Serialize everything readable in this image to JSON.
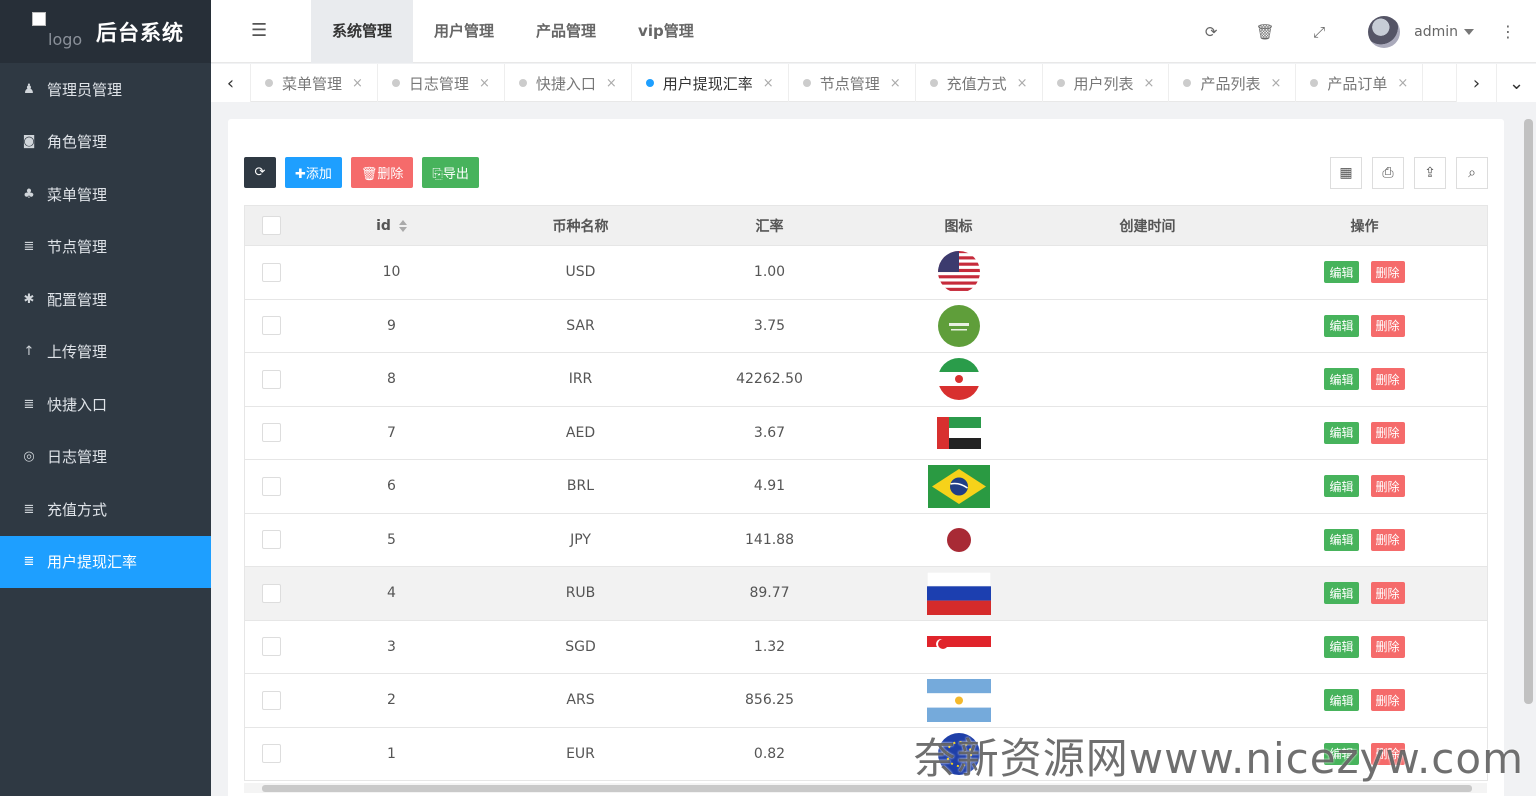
{
  "app": {
    "brand": "后台系统",
    "logo_alt": "logo"
  },
  "sidebar": {
    "items": [
      {
        "label": "管理员管理",
        "icon": "user-icon",
        "glyph": "♟"
      },
      {
        "label": "角色管理",
        "icon": "role-icon",
        "glyph": "◙"
      },
      {
        "label": "菜单管理",
        "icon": "tree-icon",
        "glyph": "♣"
      },
      {
        "label": "节点管理",
        "icon": "list-icon",
        "glyph": "≣"
      },
      {
        "label": "配置管理",
        "icon": "asterisk-icon",
        "glyph": "✱"
      },
      {
        "label": "上传管理",
        "icon": "arrow-up-icon",
        "glyph": "↑"
      },
      {
        "label": "快捷入口",
        "icon": "list-icon",
        "glyph": "≣"
      },
      {
        "label": "日志管理",
        "icon": "globe-icon",
        "glyph": "◎"
      },
      {
        "label": "充值方式",
        "icon": "list-icon",
        "glyph": "≣"
      },
      {
        "label": "用户提现汇率",
        "icon": "list-icon",
        "glyph": "≣"
      }
    ],
    "active_index": 9
  },
  "header": {
    "toggle_glyph": "☰",
    "tabs": [
      "系统管理",
      "用户管理",
      "产品管理",
      "vip管理"
    ],
    "active_tab": 0,
    "icons": [
      {
        "name": "refresh-icon",
        "glyph": "⟳"
      },
      {
        "name": "trash-icon",
        "glyph": "🗑"
      },
      {
        "name": "fullscreen-icon",
        "glyph": "⤢"
      }
    ],
    "user": "admin",
    "more_glyph": "⋮"
  },
  "page_tabs": {
    "items": [
      "菜单管理",
      "日志管理",
      "快捷入口",
      "用户提现汇率",
      "节点管理",
      "充值方式",
      "用户列表",
      "产品列表",
      "产品订单"
    ],
    "active_index": 3,
    "close": "×",
    "left": "‹",
    "right": "›",
    "down": "⌄"
  },
  "toolbar": {
    "refresh_glyph": "⟳",
    "add_label": "✚添加",
    "delete_label": "🗑删除",
    "export_label": "⎘导出",
    "right_tools": [
      {
        "name": "columns-icon",
        "glyph": "▦"
      },
      {
        "name": "print-icon",
        "glyph": "⎙"
      },
      {
        "name": "export-icon",
        "glyph": "⇪"
      },
      {
        "name": "search-icon",
        "glyph": "⌕"
      }
    ]
  },
  "table": {
    "headers": {
      "id": "id",
      "name": "币种名称",
      "rate": "汇率",
      "icon": "图标",
      "time": "创建时间",
      "op": "操作"
    },
    "edit_label": "编辑",
    "delete_label": "删除",
    "rows": [
      {
        "id": "10",
        "name": "USD",
        "rate": "1.00",
        "flag": "us",
        "time": ""
      },
      {
        "id": "9",
        "name": "SAR",
        "rate": "3.75",
        "flag": "sa",
        "time": ""
      },
      {
        "id": "8",
        "name": "IRR",
        "rate": "42262.50",
        "flag": "ir",
        "time": ""
      },
      {
        "id": "7",
        "name": "AED",
        "rate": "3.67",
        "flag": "ae",
        "time": ""
      },
      {
        "id": "6",
        "name": "BRL",
        "rate": "4.91",
        "flag": "br",
        "time": ""
      },
      {
        "id": "5",
        "name": "JPY",
        "rate": "141.88",
        "flag": "jp",
        "time": ""
      },
      {
        "id": "4",
        "name": "RUB",
        "rate": "89.77",
        "flag": "ru",
        "time": ""
      },
      {
        "id": "3",
        "name": "SGD",
        "rate": "1.32",
        "flag": "sg",
        "time": ""
      },
      {
        "id": "2",
        "name": "ARS",
        "rate": "856.25",
        "flag": "ar",
        "time": ""
      },
      {
        "id": "1",
        "name": "EUR",
        "rate": "0.82",
        "flag": "eu",
        "time": ""
      }
    ],
    "hover_row": 6
  },
  "watermark": "奈新资源网www.nicezyw.com",
  "colors": {
    "sidebar": "#2f3943",
    "accent": "#1e9fff",
    "danger": "#f56b6b",
    "success": "#47b35c"
  }
}
